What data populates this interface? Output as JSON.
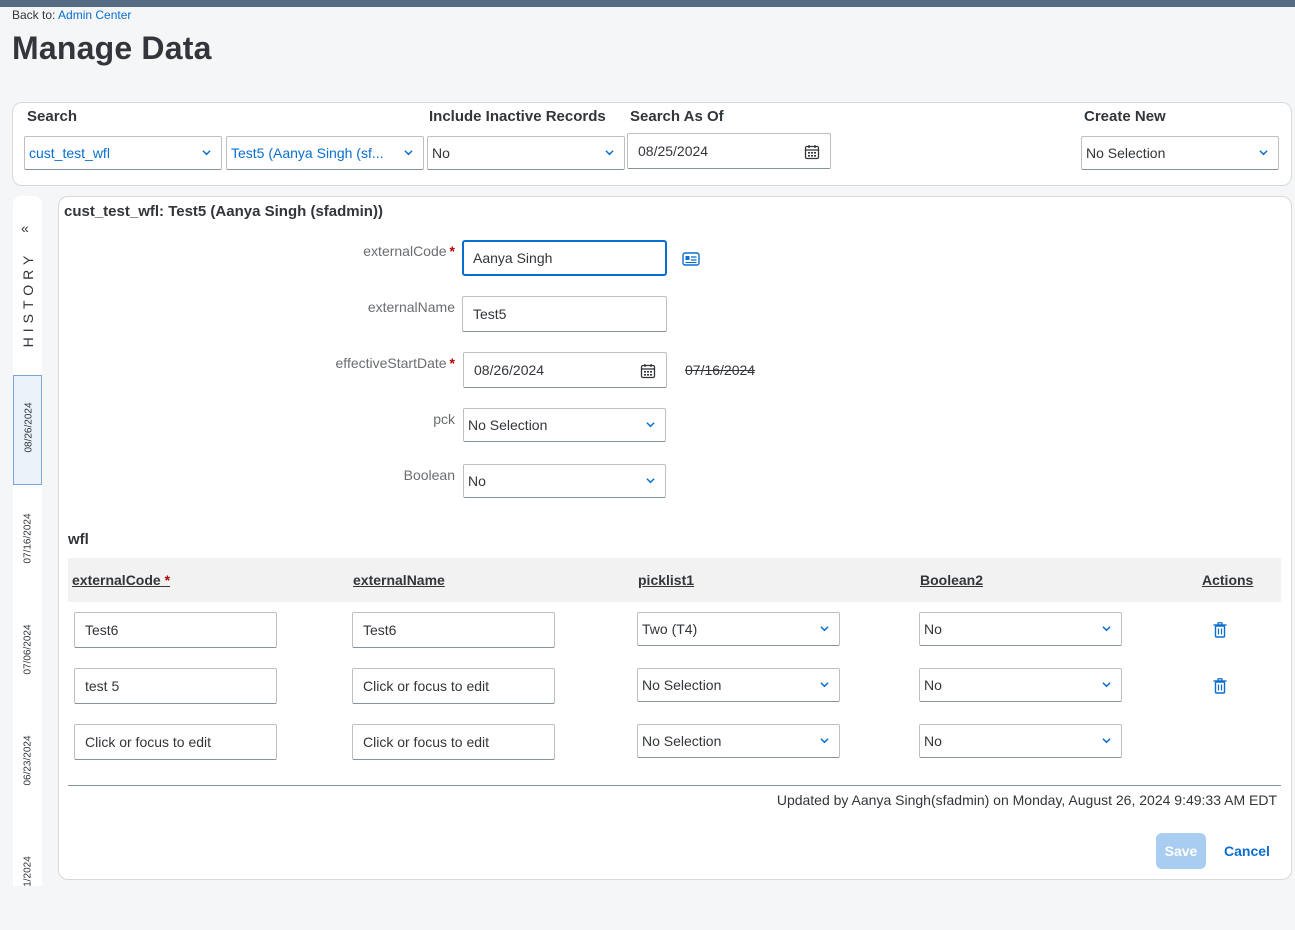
{
  "back": {
    "prefix": "Back to:",
    "link": "Admin Center"
  },
  "page_title": "Manage Data",
  "search": {
    "label": "Search",
    "object_value": "cust_test_wfl",
    "record_value": "Test5 (Aanya Singh (sf...",
    "inactive_label": "Include Inactive Records",
    "inactive_value": "No",
    "asof_label": "Search As Of",
    "asof_value": "08/25/2024",
    "create_label": "Create New",
    "create_value": "No Selection"
  },
  "history": {
    "label": "HISTORY",
    "collapse_glyph": "«",
    "dates": [
      "08/26/2024",
      "07/16/2024",
      "07/06/2024",
      "06/23/2024",
      "1/2024"
    ]
  },
  "record": {
    "title": "cust_test_wfl: Test5 (Aanya Singh (sfadmin))",
    "fields": {
      "externalCode": {
        "label": "externalCode",
        "value": "Aanya Singh"
      },
      "externalName": {
        "label": "externalName",
        "value": "Test5"
      },
      "effectiveStartDate": {
        "label": "effectiveStartDate",
        "value": "08/26/2024",
        "previous": "07/16/2024"
      },
      "pck": {
        "label": "pck",
        "value": "No Selection"
      },
      "boolean": {
        "label": "Boolean",
        "value": "No"
      }
    }
  },
  "wfl": {
    "title": "wfl",
    "required_marker": "*",
    "headers": {
      "externalCode": "externalCode",
      "externalName": "externalName",
      "picklist1": "picklist1",
      "boolean2": "Boolean2",
      "actions": "Actions"
    },
    "rows": [
      {
        "externalCode": "Test6",
        "externalName": "Test6",
        "picklist1": "Two (T4)",
        "boolean2": "No"
      },
      {
        "externalCode": "test 5",
        "externalName": "Click or focus to edit",
        "picklist1": "No Selection",
        "boolean2": "No"
      },
      {
        "externalCode": "Click or focus to edit",
        "externalName": "Click or focus to edit",
        "picklist1": "No Selection",
        "boolean2": "No"
      }
    ]
  },
  "footer": {
    "updated": "Updated by Aanya Singh(sfadmin) on Monday, August 26, 2024 9:49:33 AM EDT",
    "save": "Save",
    "cancel": "Cancel"
  },
  "colors": {
    "accent": "#0a6ed1",
    "required": "#bb0000",
    "save_disabled": "#a9cdf0",
    "topbar": "#556b82"
  }
}
